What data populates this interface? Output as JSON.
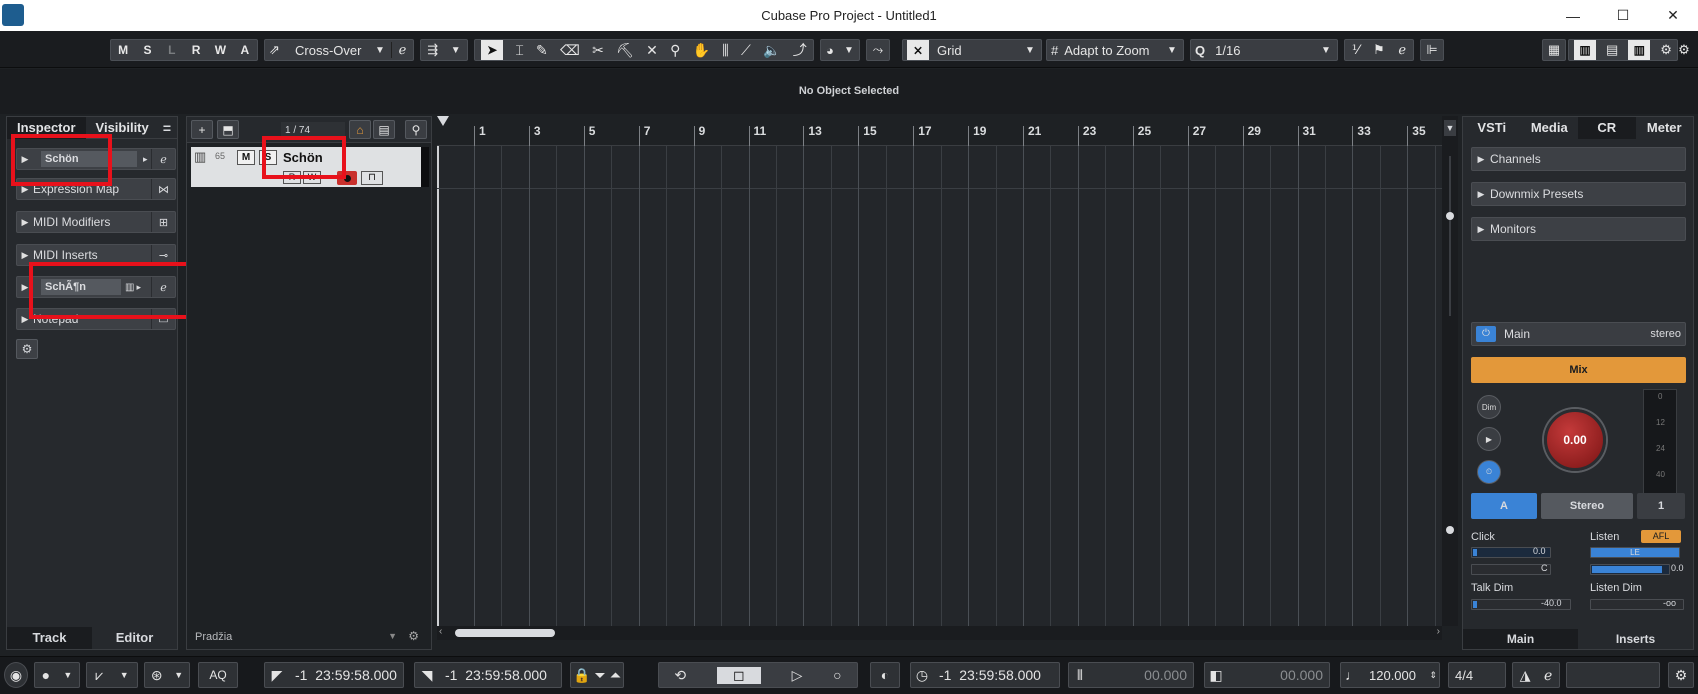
{
  "window": {
    "title": "Cubase Pro Project - Untitled1",
    "min": "—",
    "max": "☐",
    "close": "✕"
  },
  "toolbar": {
    "states": [
      "M",
      "S",
      "L",
      "R",
      "W",
      "A"
    ],
    "automation_mode": "Cross-Over",
    "snap_type": "Grid",
    "grid_type": "Adapt to Zoom",
    "quantize": "1/16"
  },
  "status_line": "No Object Selected",
  "inspector": {
    "tabs": [
      "Inspector",
      "Visibility"
    ],
    "menu_icon": "=",
    "sections": [
      {
        "label": "Schön"
      },
      {
        "label": "Expression Map"
      },
      {
        "label": "MIDI Modifiers"
      },
      {
        "label": "MIDI Inserts"
      },
      {
        "label": "SchÃ¶n"
      },
      {
        "label": "Notepad"
      }
    ],
    "bottom_tabs": [
      "Track",
      "Editor"
    ]
  },
  "tracklist": {
    "counter": "1 / 74",
    "track": {
      "number": "65",
      "name": "Schön",
      "mute": "M",
      "solo": "S"
    },
    "footer_label": "Pradžia"
  },
  "ruler": {
    "bars": [
      "1",
      "3",
      "5",
      "7",
      "9",
      "11",
      "13",
      "15",
      "17",
      "19",
      "21",
      "23",
      "25",
      "27",
      "29",
      "31",
      "33",
      "35"
    ]
  },
  "right_zone": {
    "tabs": [
      "VSTi",
      "Media",
      "CR",
      "Meter"
    ],
    "sections": [
      "Channels",
      "Downmix Presets",
      "Monitors"
    ],
    "main_label": "Main",
    "main_format": "stereo",
    "mix_button": "Mix",
    "dim_label": "Dim",
    "knob_value": "0.00",
    "meter_scale": [
      "0",
      "12",
      "24",
      "40"
    ],
    "a_button": "A",
    "stereo_button": "Stereo",
    "one_button": "1",
    "click_label": "Click",
    "click_value": "0.0",
    "click_pan": "C",
    "listen_label": "Listen",
    "afl_badge": "AFL",
    "le_badge": "LE",
    "listen_value": "0.0",
    "talk_dim_label": "Talk Dim",
    "talk_dim_value": "-40.0",
    "listen_dim_label": "Listen Dim",
    "listen_dim_value": "-oo",
    "bottom_tabs": [
      "Main",
      "Inserts"
    ]
  },
  "transport": {
    "aq": "AQ",
    "left_locator": "-1  23:59:58.000",
    "right_locator": "-1  23:59:58.000",
    "position": "-1  23:59:58.000",
    "secondary_time": "00.000",
    "tertiary_time": "00.000",
    "tempo": "120.000",
    "signature": "4/4"
  },
  "colors": {
    "accent_blue": "#3a83d6",
    "mix_orange": "#e3983a",
    "record_red": "#c9302c",
    "highlight_red": "#e8111b"
  }
}
